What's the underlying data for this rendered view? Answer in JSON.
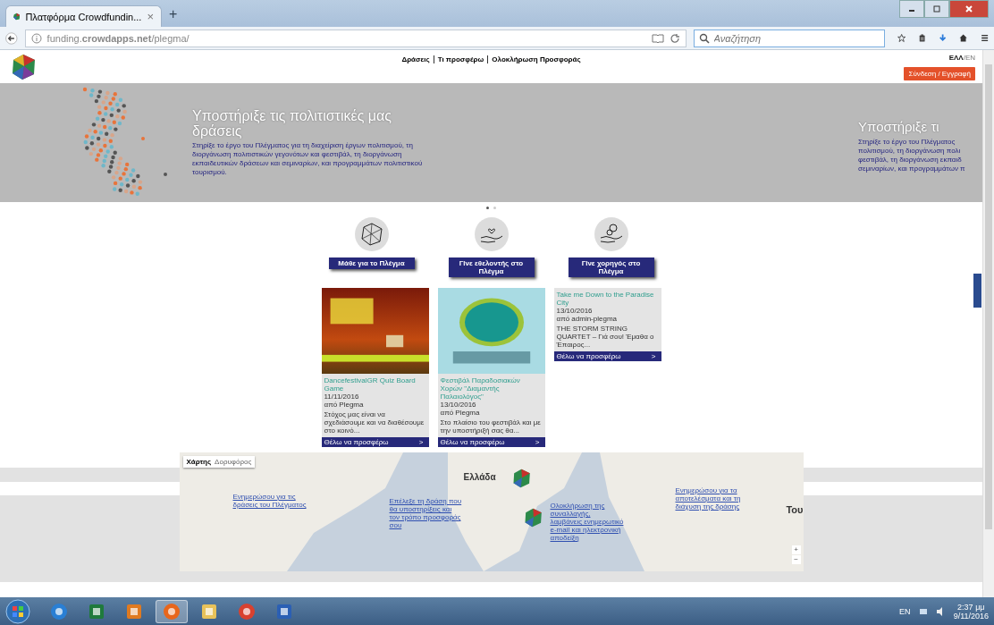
{
  "browser": {
    "tab_title": "Πλατφόρμα Crowdfundin...",
    "tab_close": "×",
    "new_tab": "+",
    "url": "funding.**crowdapps.net**/plegma/",
    "search_placeholder": "Αναζήτηση"
  },
  "header": {
    "nav": [
      {
        "label": "Δράσεις"
      },
      {
        "label": "Τι προσφέρω"
      },
      {
        "label": "Ολοκλήρωση Προσφοράς"
      }
    ],
    "languages": [
      {
        "label": "ΕΛΛ",
        "selected": true
      },
      {
        "label": "EN",
        "selected": false
      }
    ],
    "language_separator": "/",
    "login_button": "Σύνδεση / Εγγραφή"
  },
  "hero": {
    "slides": [
      {
        "heading": "Υποστήριξε τις πολιτιστικές μας δράσεις",
        "text": "Στηρίξε το έργο του Πλέγματος για τη διαχείριση έργων πολιτισμού, τη διοργάνωση πολιτιστικών γεγονότων και φεστιβάλ, τη διοργάνωση εκπαιδευτικών δράσεων και σεμιναρίων, και προγραμμάτων πολιτιστικού τουρισμού."
      },
      {
        "heading": "Υποστήριξε τι",
        "lines": [
          "Στηρίξε το έργο του Πλέγματος",
          "πολιτισμού, τη διοργάνωση πολι",
          "φεστιβάλ, τη διοργάνωση εκπαιδ",
          "σεμιναρίων, και προγραμμάτων π"
        ]
      }
    ],
    "dots": [
      {
        "selected": true
      },
      {
        "selected": false
      }
    ]
  },
  "features": [
    {
      "kind": "network",
      "label": "Μάθε για το Πλέγμα"
    },
    {
      "kind": "heart-hand",
      "label": "Γίνε εθελοντής στο Πλέγμα"
    },
    {
      "kind": "coin-hand",
      "label": "Γίνε χορηγός στο Πλέγμα"
    }
  ],
  "cards": [
    {
      "kind": "quiz-poster",
      "title": "DancefestivalGR Quiz Board Game",
      "date": "11/11/2016",
      "author": "από Plegma",
      "excerpt": "Στόχος μας είναι να σχεδιάσουμε και να διαθέσουμε στο κοινό...",
      "button": "Θέλω να προσφέρω",
      "arrow": ">"
    },
    {
      "kind": "festival-poster",
      "title": "Φεστιβάλ Παραδοσιακών Χορών \"Διαμαντής Παλαιολόγος\"",
      "date": "13/10/2016",
      "author": "από Plegma",
      "excerpt": "Στο πλαίσιο του φεστιβάλ και με την υποστήριξή σας θα...",
      "button": "Θέλω να προσφέρω",
      "arrow": ">"
    },
    {
      "kind": "text-only",
      "title": "Take me Down to the Paradise City",
      "date": "13/10/2016",
      "author": "από admin-plegma",
      "excerpt": "THE STORM STRING QUARTET – Γιά σου! Έμαθα ο Έπαιρος...",
      "button": "Θέλω να προσφέρω",
      "arrow": ">"
    }
  ],
  "map": {
    "tabs": [
      {
        "label": "Χάρτης",
        "selected": true
      },
      {
        "label": "Δορυφόρος",
        "selected": false
      }
    ],
    "country_label": "Ελλάδα",
    "edge_label": "Του",
    "steps": [
      "Ενημερώσου για τις δράσεις του Πλέγματος",
      "Επέλεξε τη δράση που θα υποστηρίξεις και τον τρόπο προσφοράς σου",
      "Ολοκλήρωση της συναλλαγής, λαμβάνεις ενημερωτικό e-mail και ηλεκτρονική αποδείξη",
      "Ενημερώσου για τα αποτελέσματα και τη διάχυση της δράσης"
    ],
    "zoom_in": "+",
    "zoom_out": "−"
  },
  "taskbar": {
    "apps": [
      {
        "kind": "ie",
        "selected": false
      },
      {
        "kind": "excel",
        "selected": false
      },
      {
        "kind": "media",
        "selected": false
      },
      {
        "kind": "firefox",
        "selected": true
      },
      {
        "kind": "folder",
        "selected": false
      },
      {
        "kind": "chrome",
        "selected": false
      },
      {
        "kind": "word",
        "selected": false
      }
    ],
    "language": "EN",
    "time": "2:37 μμ",
    "date": "9/11/2016"
  }
}
